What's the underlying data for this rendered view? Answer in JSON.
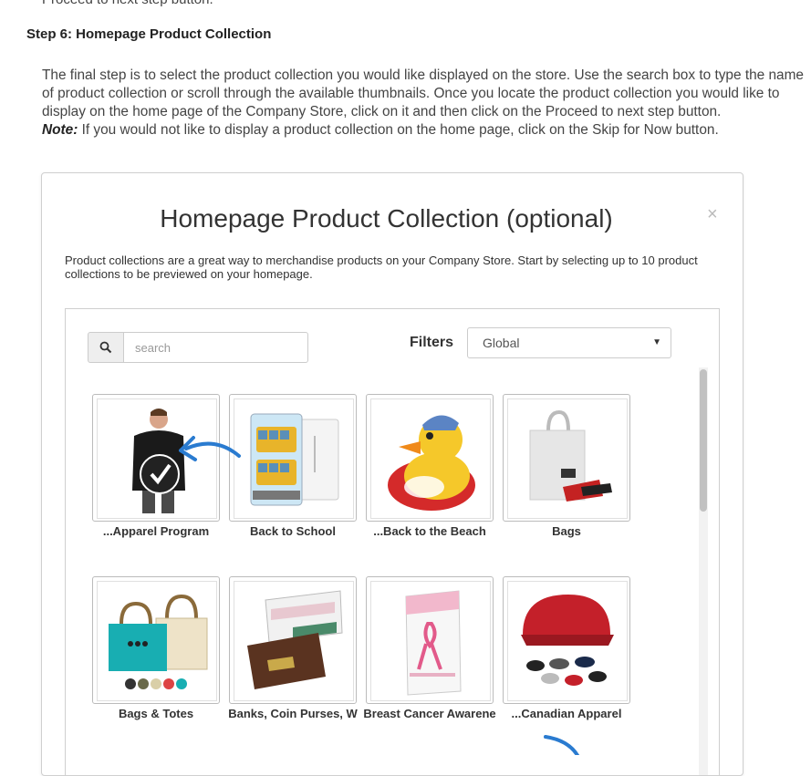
{
  "header": {
    "cutoff_text": "Proceed to next step button.",
    "step_title": "Step 6: Homepage Product Collection",
    "paragraph": "The final step is to select the product collection you would like displayed on the store. Use the search box to type the name of product collection or scroll through the available thumbnails. Once you locate the product collection you would like to display on the home page of the Company Store, click on it and then click on the Proceed to next step button.",
    "note_label": "Note:",
    "note_text": " If you would not like to display a product collection on the home page, click on the Skip for Now button."
  },
  "modal": {
    "title": "Homepage Product Collection (optional)",
    "close_glyph": "×",
    "description": "Product collections are a great way to merchandise products on your Company Store. Start by selecting up to 10 product collections to be previewed on your homepage.",
    "search": {
      "placeholder": "search",
      "value": ""
    },
    "filters_label": "Filters",
    "filter_selected": "Global",
    "collections": [
      {
        "label": "...Apparel Program",
        "icon": "apparel-image",
        "selected": true
      },
      {
        "label": "Back to School",
        "icon": "school-bus-image",
        "selected": false
      },
      {
        "label": "...Back to the Beach",
        "icon": "rubber-duck-image",
        "selected": false
      },
      {
        "label": "Bags",
        "icon": "tote-bag-image",
        "selected": false
      },
      {
        "label": "Bags & Totes",
        "icon": "totes-image",
        "selected": false
      },
      {
        "label": "Banks, Coin Purses, W",
        "icon": "checkbook-image",
        "selected": false
      },
      {
        "label": "Breast Cancer Awarene",
        "icon": "breast-cancer-brochure-image",
        "selected": false
      },
      {
        "label": "...Canadian Apparel",
        "icon": "caps-image",
        "selected": false
      }
    ]
  },
  "colors": {
    "accent_arrow": "#2a7bd0",
    "accent_red": "#cc2233"
  }
}
